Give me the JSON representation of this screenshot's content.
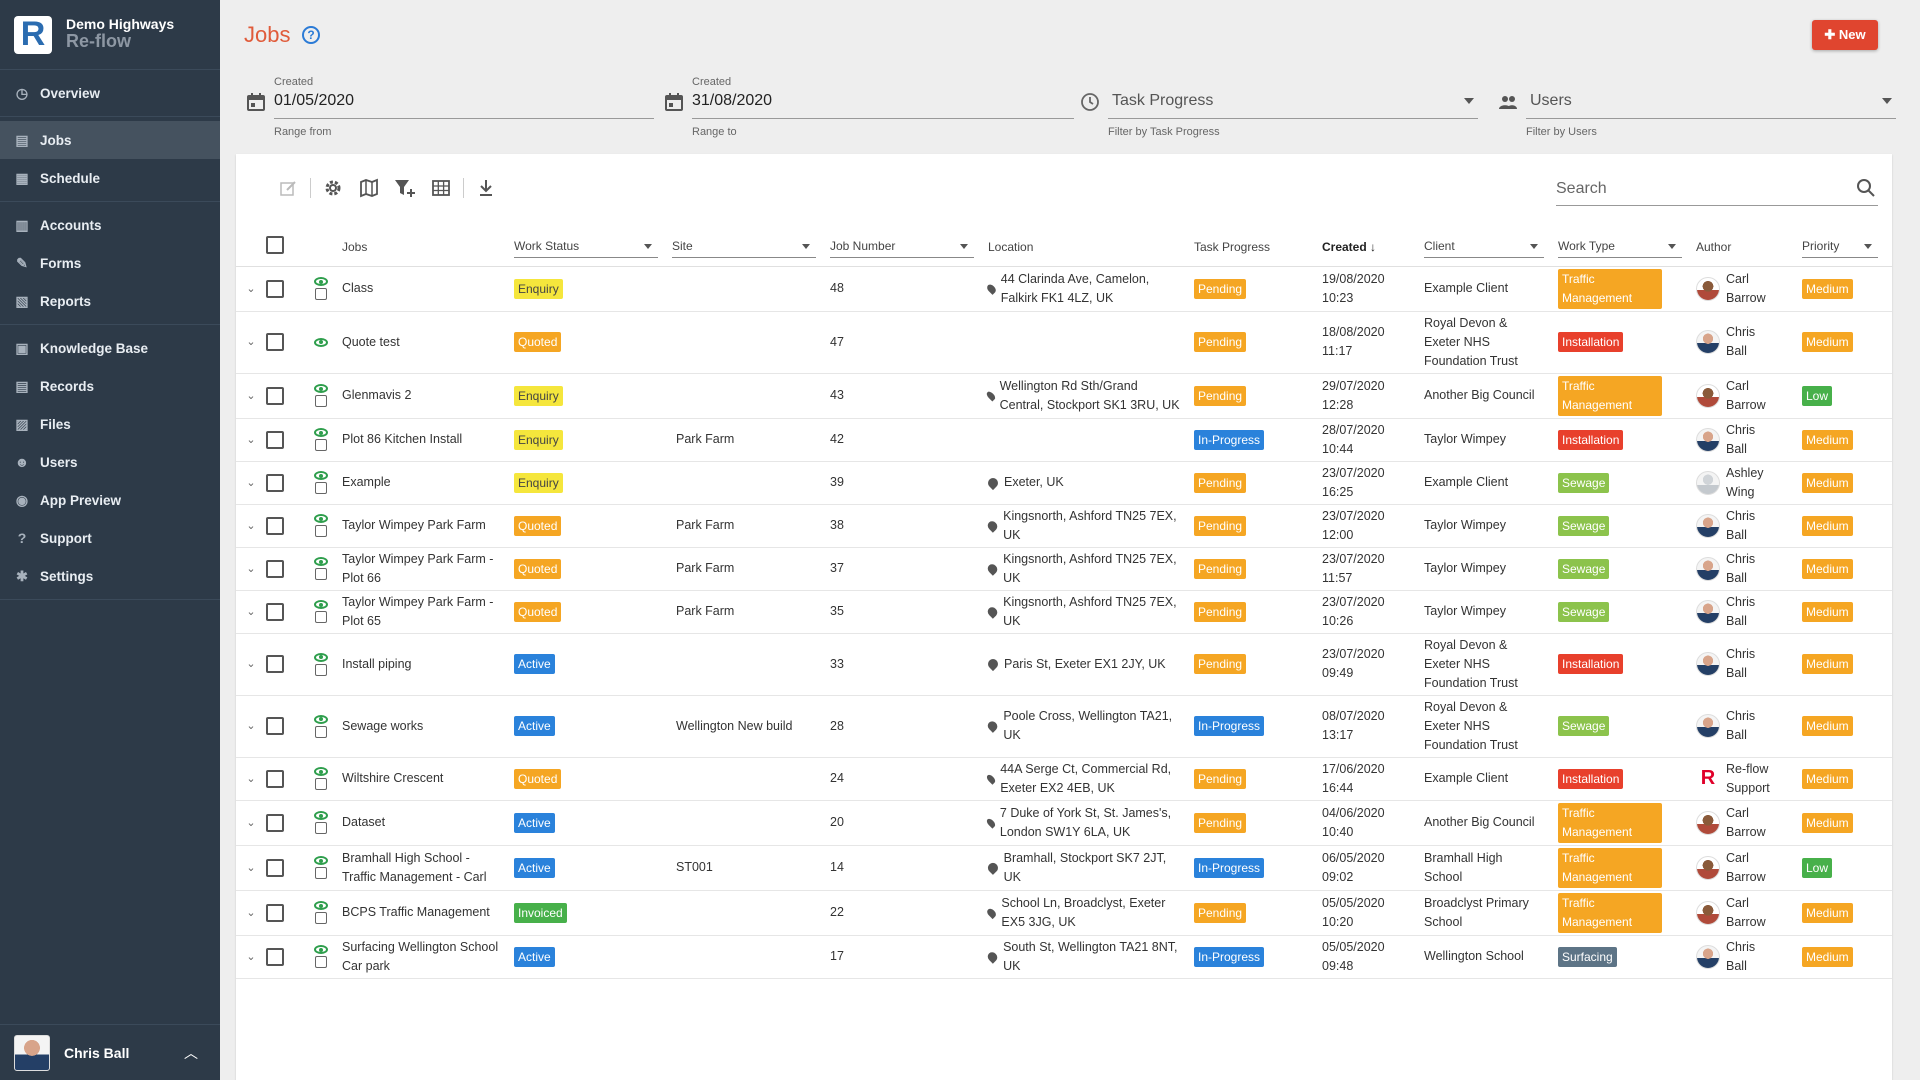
{
  "brand": {
    "org": "Demo Highways",
    "app": "Re-flow",
    "logo_letter": "R"
  },
  "sidebar": {
    "groups": [
      [
        {
          "label": "Overview",
          "icon": "clock-icon"
        }
      ],
      [
        {
          "label": "Jobs",
          "icon": "jobs-icon",
          "active": true
        },
        {
          "label": "Schedule",
          "icon": "calendar-icon"
        }
      ],
      [
        {
          "label": "Accounts",
          "icon": "accounts-icon"
        },
        {
          "label": "Forms",
          "icon": "forms-icon"
        },
        {
          "label": "Reports",
          "icon": "reports-icon"
        }
      ],
      [
        {
          "label": "Knowledge Base",
          "icon": "book-icon"
        },
        {
          "label": "Records",
          "icon": "records-icon"
        },
        {
          "label": "Files",
          "icon": "files-icon"
        },
        {
          "label": "Users",
          "icon": "users-icon"
        },
        {
          "label": "App Preview",
          "icon": "eye-icon"
        },
        {
          "label": "Support",
          "icon": "help-icon"
        },
        {
          "label": "Settings",
          "icon": "gear-icon"
        }
      ]
    ],
    "user": {
      "name": "Chris Ball"
    }
  },
  "header": {
    "title": "Jobs",
    "help": "?",
    "new_button": "New"
  },
  "filters": {
    "created_from": {
      "caption": "Created",
      "value": "01/05/2020",
      "helper": "Range from"
    },
    "created_to": {
      "caption": "Created",
      "value": "31/08/2020",
      "helper": "Range to"
    },
    "task_progress": {
      "placeholder": "Task Progress",
      "helper": "Filter by Task Progress"
    },
    "users": {
      "placeholder": "Users",
      "helper": "Filter by Users"
    }
  },
  "search": {
    "placeholder": "Search"
  },
  "columns": [
    "Jobs",
    "Work Status",
    "Site",
    "Job Number",
    "Location",
    "Task Progress",
    "Created",
    "Client",
    "Work Type",
    "Author",
    "Priority"
  ],
  "colors": {
    "Enquiry": "#f5e63c",
    "Quoted": "#f5a623",
    "Active": "#2a82db",
    "Invoiced": "#47b04a",
    "Pending": "#f5a623",
    "In-Progress": "#2a82db",
    "Traffic Management": "#f5a623",
    "Installation": "#e8402c",
    "Sewage": "#8cc34c",
    "Surfacing": "#5d7486",
    "Medium": "#f5a623",
    "Low": "#47b04a",
    "accent": "#e05b3a",
    "sidebar": "#2d3a48"
  },
  "rows": [
    {
      "job": "Class",
      "status": "Enquiry",
      "site": "",
      "number": "48",
      "location": "44 Clarinda Ave, Camelon, Falkirk FK1 4LZ, UK",
      "progress": "Pending",
      "created": "19/08/2020 10:23",
      "client": "Example Client",
      "work_type": "Traffic Management",
      "author": "Carl Barrow",
      "author_av": "carl",
      "priority": "Medium"
    },
    {
      "job": "Quote test",
      "status": "Quoted",
      "site": "",
      "number": "47",
      "location": "",
      "progress": "Pending",
      "created": "18/08/2020 11:17",
      "client": "Royal Devon & Exeter NHS Foundation Trust",
      "work_type": "Installation",
      "author": "Chris Ball",
      "author_av": "chris",
      "priority": "Medium"
    },
    {
      "job": "Glenmavis 2",
      "status": "Enquiry",
      "site": "",
      "number": "43",
      "location": "Wellington Rd Sth/Grand Central, Stockport SK1 3RU, UK",
      "progress": "Pending",
      "created": "29/07/2020 12:28",
      "client": "Another Big Council",
      "work_type": "Traffic Management",
      "author": "Carl Barrow",
      "author_av": "carl",
      "priority": "Low"
    },
    {
      "job": "Plot 86 Kitchen Install",
      "status": "Enquiry",
      "site": "Park Farm",
      "number": "42",
      "location": "",
      "progress": "In-Progress",
      "created": "28/07/2020 10:44",
      "client": "Taylor Wimpey",
      "work_type": "Installation",
      "author": "Chris Ball",
      "author_av": "chris",
      "priority": "Medium"
    },
    {
      "job": "Example",
      "status": "Enquiry",
      "site": "",
      "number": "39",
      "location": "Exeter, UK",
      "progress": "Pending",
      "created": "23/07/2020 16:25",
      "client": "Example Client",
      "work_type": "Sewage",
      "author": "Ashley Wing",
      "author_av": "ashley",
      "priority": "Medium"
    },
    {
      "job": "Taylor Wimpey Park Farm",
      "status": "Quoted",
      "site": "Park Farm",
      "number": "38",
      "location": "Kingsnorth, Ashford TN25 7EX, UK",
      "progress": "Pending",
      "created": "23/07/2020 12:00",
      "client": "Taylor Wimpey",
      "work_type": "Sewage",
      "author": "Chris Ball",
      "author_av": "chris",
      "priority": "Medium"
    },
    {
      "job": "Taylor Wimpey Park Farm - Plot 66",
      "status": "Quoted",
      "site": "Park Farm",
      "number": "37",
      "location": "Kingsnorth, Ashford TN25 7EX, UK",
      "progress": "Pending",
      "created": "23/07/2020 11:57",
      "client": "Taylor Wimpey",
      "work_type": "Sewage",
      "author": "Chris Ball",
      "author_av": "chris",
      "priority": "Medium"
    },
    {
      "job": "Taylor Wimpey Park Farm - Plot 65",
      "status": "Quoted",
      "site": "Park Farm",
      "number": "35",
      "location": "Kingsnorth, Ashford TN25 7EX, UK",
      "progress": "Pending",
      "created": "23/07/2020 10:26",
      "client": "Taylor Wimpey",
      "work_type": "Sewage",
      "author": "Chris Ball",
      "author_av": "chris",
      "priority": "Medium"
    },
    {
      "job": "Install piping",
      "status": "Active",
      "site": "",
      "number": "33",
      "location": "Paris St, Exeter EX1 2JY, UK",
      "progress": "Pending",
      "created": "23/07/2020 09:49",
      "client": "Royal Devon & Exeter NHS Foundation Trust",
      "work_type": "Installation",
      "author": "Chris Ball",
      "author_av": "chris",
      "priority": "Medium"
    },
    {
      "job": "Sewage works",
      "status": "Active",
      "site": "Wellington New build",
      "number": "28",
      "location": "Poole Cross, Wellington TA21, UK",
      "progress": "In-Progress",
      "created": "08/07/2020 13:17",
      "client": "Royal Devon & Exeter NHS Foundation Trust",
      "work_type": "Sewage",
      "author": "Chris Ball",
      "author_av": "chris",
      "priority": "Medium"
    },
    {
      "job": "Wiltshire Crescent",
      "status": "Quoted",
      "site": "",
      "number": "24",
      "location": "44A Serge Ct, Commercial Rd, Exeter EX2 4EB, UK",
      "progress": "Pending",
      "created": "17/06/2020 16:44",
      "client": "Example Client",
      "work_type": "Installation",
      "author": "Re-flow Support",
      "author_av": "reflow",
      "priority": "Medium"
    },
    {
      "job": "Dataset",
      "status": "Active",
      "site": "",
      "number": "20",
      "location": "7 Duke of York St, St. James's, London SW1Y 6LA, UK",
      "progress": "Pending",
      "created": "04/06/2020 10:40",
      "client": "Another Big Council",
      "work_type": "Traffic Management",
      "author": "Carl Barrow",
      "author_av": "carl",
      "priority": "Medium"
    },
    {
      "job": "Bramhall High School - Traffic Management - Carl",
      "status": "Active",
      "site": "ST001",
      "number": "14",
      "location": "Bramhall, Stockport SK7 2JT, UK",
      "progress": "In-Progress",
      "created": "06/05/2020 09:02",
      "client": "Bramhall High School",
      "work_type": "Traffic Management",
      "author": "Carl Barrow",
      "author_av": "carl",
      "priority": "Low"
    },
    {
      "job": "BCPS Traffic Management",
      "status": "Invoiced",
      "site": "",
      "number": "22",
      "location": "School Ln, Broadclyst, Exeter EX5 3JG, UK",
      "progress": "Pending",
      "created": "05/05/2020 10:20",
      "client": "Broadclyst Primary School",
      "work_type": "Traffic Management",
      "author": "Carl Barrow",
      "author_av": "carl",
      "priority": "Medium"
    },
    {
      "job": "Surfacing Wellington School Car park",
      "status": "Active",
      "site": "",
      "number": "17",
      "location": "South St, Wellington TA21 8NT, UK",
      "progress": "In-Progress",
      "created": "05/05/2020 09:48",
      "client": "Wellington School",
      "work_type": "Surfacing",
      "author": "Chris Ball",
      "author_av": "chris",
      "priority": "Medium"
    }
  ]
}
